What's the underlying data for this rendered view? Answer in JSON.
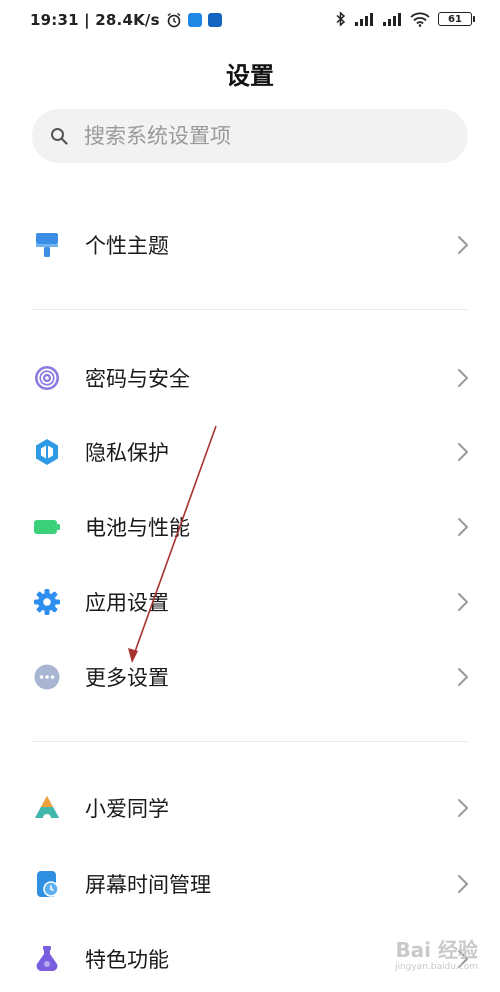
{
  "status_bar": {
    "time_speed": "19:31 | 28.4K/s",
    "battery": "61",
    "left_icons": [
      "alarm-icon",
      "zhihu-app-icon",
      "app-icon"
    ],
    "right_icons": [
      "bluetooth-icon",
      "signal-icon",
      "hd-signal-icon",
      "wifi-icon",
      "battery-icon"
    ]
  },
  "header": {
    "title": "设置"
  },
  "search": {
    "placeholder": "搜索系统设置项"
  },
  "groups": [
    {
      "items": [
        {
          "label": "个性主题",
          "icon": "brush-icon",
          "color": "#3a8ee6"
        }
      ]
    },
    {
      "items": [
        {
          "label": "密码与安全",
          "icon": "fingerprint-icon",
          "color": "#7e6fd6"
        },
        {
          "label": "隐私保护",
          "icon": "privacy-shield-icon",
          "color": "#2f9be4"
        },
        {
          "label": "电池与性能",
          "icon": "battery-icon",
          "color": "#3bd07a"
        },
        {
          "label": "应用设置",
          "icon": "gear-icon",
          "color": "#2f8ff0"
        },
        {
          "label": "更多设置",
          "icon": "more-dots-icon",
          "color": "#9aa8c8"
        }
      ]
    },
    {
      "items": [
        {
          "label": "小爱同学",
          "icon": "xiaoai-icon",
          "color": "#6f5ce8"
        },
        {
          "label": "屏幕时间管理",
          "icon": "screen-time-icon",
          "color": "#2f8fe0"
        },
        {
          "label": "特色功能",
          "icon": "flask-icon",
          "color": "#7a5ee0"
        }
      ]
    }
  ],
  "watermark": {
    "main": "Bai 经验",
    "sub": "jingyan.baidu.com"
  }
}
